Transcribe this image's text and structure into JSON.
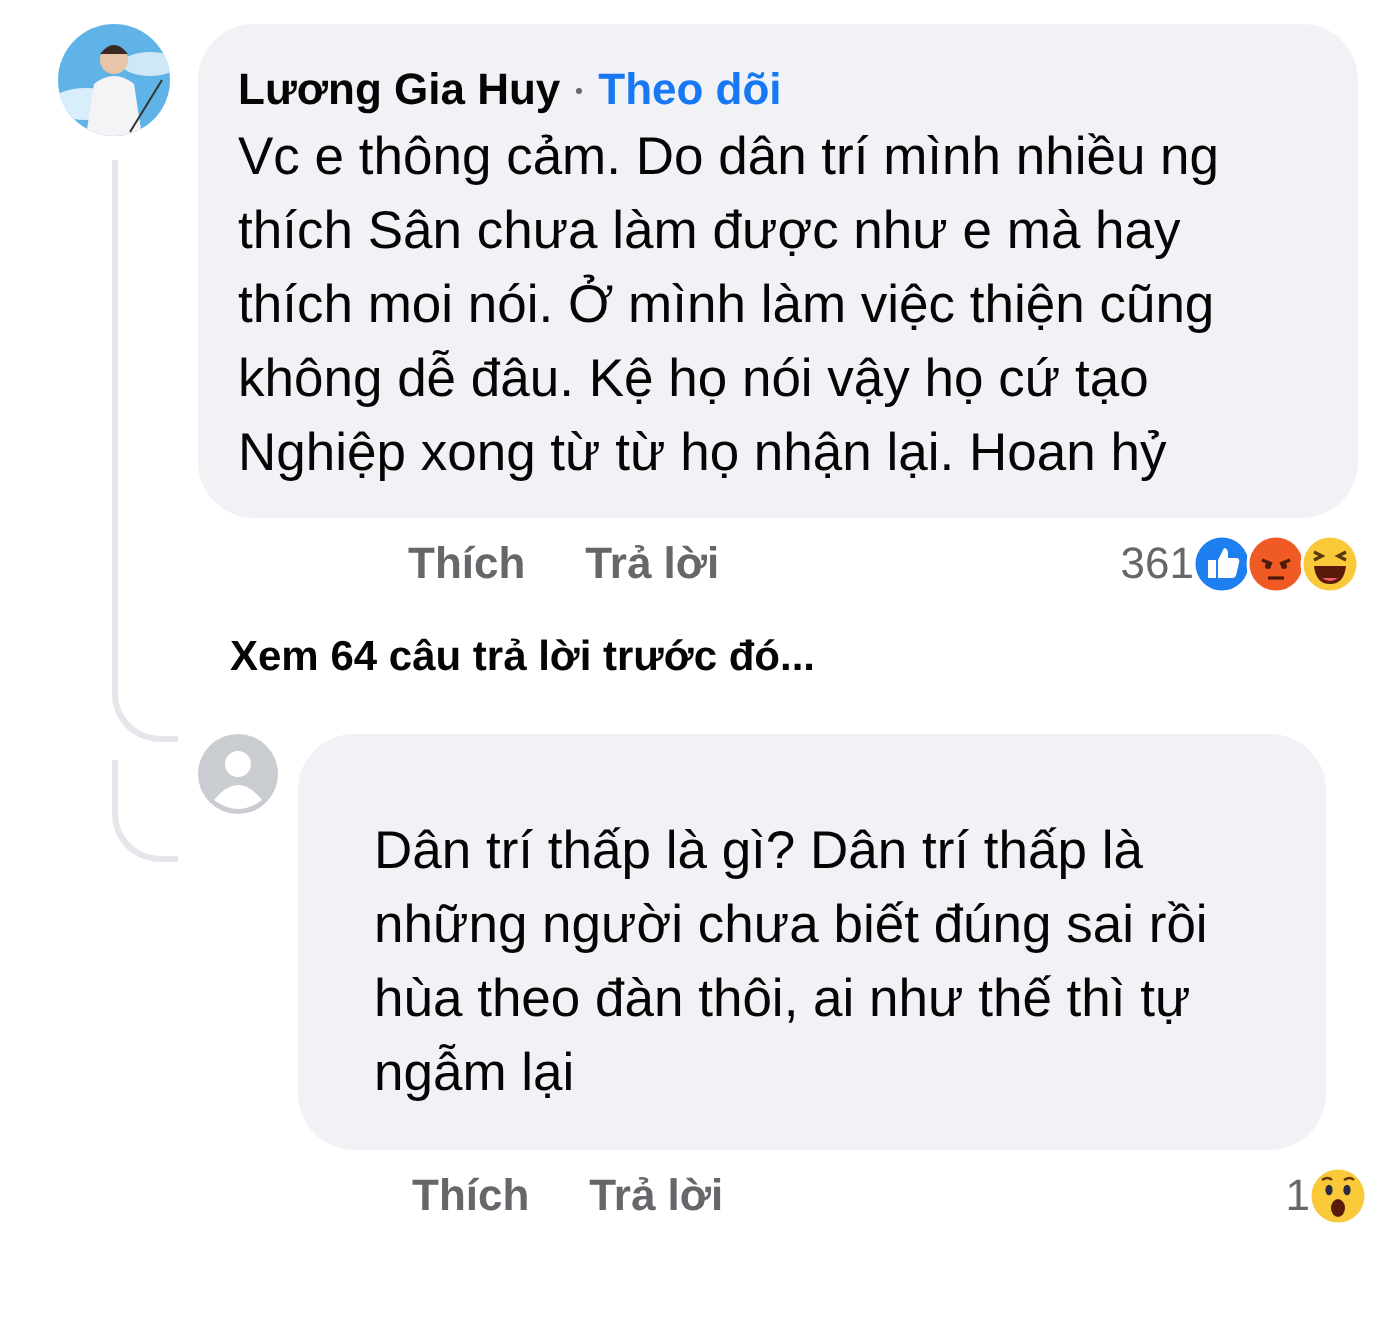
{
  "comments": [
    {
      "author": "Lương Gia Huy",
      "follow": "Theo dõi",
      "text": "Vc e thông cảm. Do dân trí mình nhiều ng thích Sân chưa làm được như e mà hay thích moi nói. Ở mình làm việc thiện cũng không dễ đâu. Kệ họ nói vậy họ cứ tạo Nghiệp xong từ từ họ nhận lại. Hoan hỷ",
      "actions": [
        "Thích",
        "Trả lời"
      ],
      "reaction_count": "361",
      "reactions": [
        {
          "kind": "like"
        },
        {
          "kind": "angry"
        },
        {
          "kind": "haha"
        }
      ]
    }
  ],
  "more_replies": "Xem 64 câu trả lời trước đó...",
  "reply": {
    "text": "Dân trí thấp là gì? Dân trí thấp là những người chưa biết đúng sai rồi hùa theo đàn thôi, ai như thế thì tự ngẫm lại",
    "actions": [
      "Thích",
      "Trả lời"
    ],
    "reaction_count": "1",
    "reactions": [
      {
        "kind": "wow"
      }
    ]
  }
}
